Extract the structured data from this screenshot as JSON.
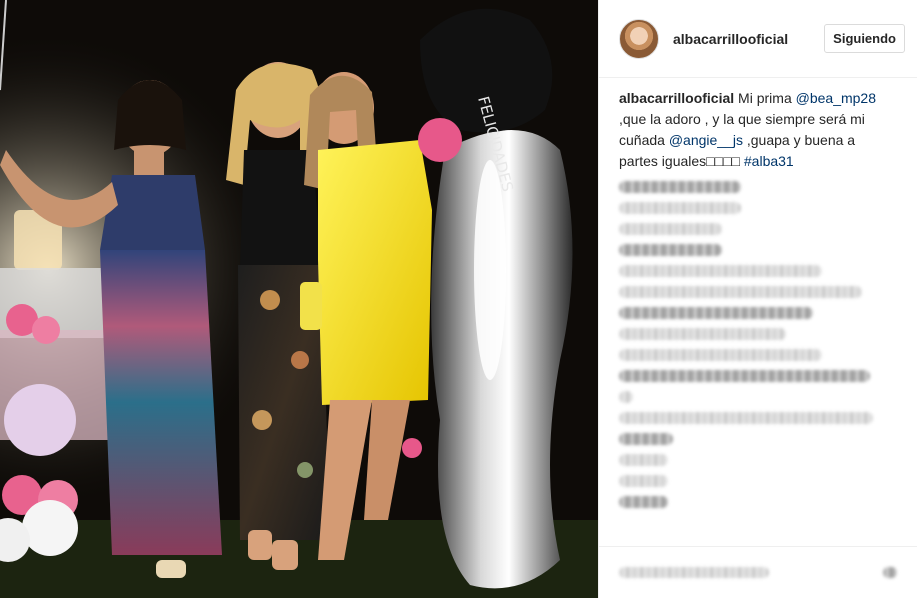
{
  "post": {
    "photo_alt": "",
    "balloon_text": "FELICIDADES"
  },
  "header": {
    "username": "albacarrillooficial",
    "follow_label": "Siguiendo"
  },
  "caption": {
    "username": "albacarrillooficial",
    "part1": " Mi prima ",
    "mention1": "@bea_mp28",
    "part2": " ,que la adoro , y la que siempre será mi cuñada ",
    "mention2": "@angie__js",
    "part3": " ,guapa y buena a partes iguales□□□□ ",
    "hashtag": "#alba31"
  },
  "comments": [
    {
      "blur": 0.45
    },
    {
      "blur": 0.45
    },
    {
      "blur": 0.38
    },
    {
      "blur": 0.38
    },
    {
      "blur": 0.75
    },
    {
      "blur": 0.9
    },
    {
      "blur": 0.72
    },
    {
      "blur": 0.62
    },
    {
      "blur": 0.75
    },
    {
      "blur": 0.93
    },
    {
      "blur": 0.05
    },
    {
      "blur": 0.94
    },
    {
      "blur": 0.2
    },
    {
      "blur": 0.18
    },
    {
      "blur": 0.18
    },
    {
      "blur": 0.18
    }
  ],
  "footer": {
    "more": true
  },
  "colors": {
    "link": "#003569",
    "border": "#efefef",
    "text": "#262626"
  }
}
